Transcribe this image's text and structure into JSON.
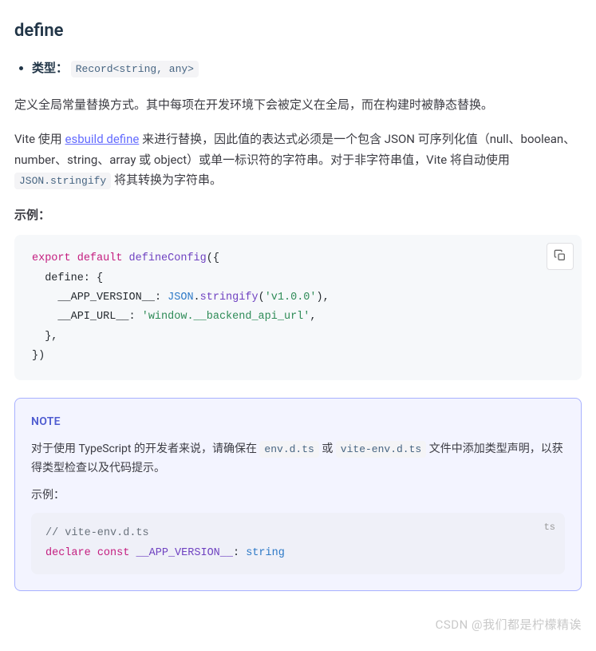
{
  "title": "define",
  "meta": {
    "type_label": "类型：",
    "type_value": "Record<string, any>"
  },
  "paragraph1": "定义全局常量替换方式。其中每项在开发环境下会被定义在全局，而在构建时被静态替换。",
  "paragraph2": {
    "prefix": "Vite 使用 ",
    "link": "esbuild define",
    "mid": " 来进行替换，因此值的表达式必须是一个包含 JSON 可序列化值（null、boolean、number、string、array 或 object）或单一标识符的字符串。对于非字符串值，Vite 将自动使用 ",
    "code": "JSON.stringify",
    "suffix": " 将其转换为字符串。"
  },
  "example_label": "示例：",
  "code1": {
    "kw_export": "export",
    "kw_default": "default",
    "fn": "defineConfig",
    "open": "({",
    "l2": "  define: {",
    "l3_key": "    __APP_VERSION__",
    "l3_mid": ": ",
    "l3_json": "JSON",
    "l3_dot": ".",
    "l3_strfn": "stringify",
    "l3_paren": "(",
    "l3_val": "'v1.0.0'",
    "l3_end": "),",
    "l4_key": "    __API_URL__",
    "l4_mid": ": ",
    "l4_val": "'window.__backend_api_url'",
    "l4_end": ",",
    "l5": "  },",
    "l6": "})"
  },
  "note": {
    "title": "NOTE",
    "p_prefix": "对于使用 TypeScript 的开发者来说，请确保在 ",
    "code1": "env.d.ts",
    "p_mid": " 或 ",
    "code2": "vite-env.d.ts",
    "p_suffix": " 文件中添加类型声明，以获得类型检查以及代码提示。",
    "sub_label": "示例：",
    "lang_badge": "ts",
    "code": {
      "cmt": "// vite-env.d.ts",
      "declare": "declare",
      "const": "const",
      "name": "__APP_VERSION__",
      "colon": ": ",
      "type": "string"
    }
  },
  "watermark": "CSDN @我们都是柠檬精诶"
}
